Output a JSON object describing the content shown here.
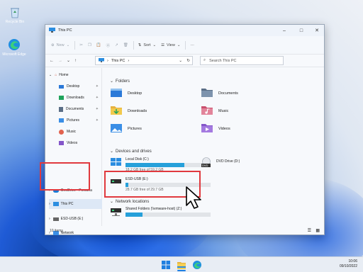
{
  "desktop": {
    "icons": [
      {
        "label": "Recycle Bin",
        "icon": "recycle-bin-icon"
      },
      {
        "label": "Microsoft Edge",
        "icon": "edge-icon"
      }
    ]
  },
  "window": {
    "title": "This PC",
    "controls": [
      "minimize",
      "maximize",
      "close"
    ],
    "toolbar": {
      "new_label": "New",
      "sort_label": "Sort",
      "view_label": "View",
      "more_label": "···"
    },
    "address": {
      "path": "This PC",
      "search_placeholder": "Search This PC"
    },
    "navigation": [
      {
        "label": "Home",
        "icon": "home-icon"
      },
      {
        "label": "Desktop",
        "icon": "desktop-folder-icon"
      },
      {
        "label": "Downloads",
        "icon": "downloads-folder-icon"
      },
      {
        "label": "Documents",
        "icon": "documents-folder-icon"
      },
      {
        "label": "Pictures",
        "icon": "pictures-folder-icon"
      },
      {
        "label": "Music",
        "icon": "music-folder-icon"
      },
      {
        "label": "Videos",
        "icon": "videos-folder-icon"
      },
      {
        "label": "OneDrive - Persona",
        "icon": "onedrive-icon"
      },
      {
        "label": "This PC",
        "icon": "pc-icon"
      },
      {
        "label": "ESD-USB (E:)",
        "icon": "usb-drive-icon"
      },
      {
        "label": "Network",
        "icon": "network-icon"
      }
    ],
    "sections": {
      "folders": "Folders",
      "devices": "Devices and drives",
      "network": "Network locations"
    },
    "folders": [
      {
        "label": "Desktop",
        "color": "#2b79d8"
      },
      {
        "label": "Documents",
        "color": "#5a6e86"
      },
      {
        "label": "Downloads",
        "color": "#1fa35b"
      },
      {
        "label": "Music",
        "color": "#e2624e"
      },
      {
        "label": "Pictures",
        "color": "#3a8ee6"
      },
      {
        "label": "Videos",
        "color": "#8456c9"
      }
    ],
    "drives": [
      {
        "label": "Local Disk (C:)",
        "free": "18.2 GB free of 59.2 GB",
        "used_fraction": 0.69
      },
      {
        "label": "DVD Drive (D:)",
        "badge": "DVD"
      },
      {
        "label": "ESD-USB (E:)",
        "free": "28.7 GB free of 29.7 GB",
        "used_fraction": 0.03
      },
      {
        "label": "Shared Folders (\\\\vmware-host) (Z:)",
        "used_fraction": 0.2
      }
    ],
    "status": "10 items"
  },
  "taskbar": {
    "icons": [
      "start-icon",
      "file-explorer-icon",
      "edge-icon"
    ],
    "time": "10:06",
    "date": "09/10/2022"
  },
  "accent": "#e0393e"
}
